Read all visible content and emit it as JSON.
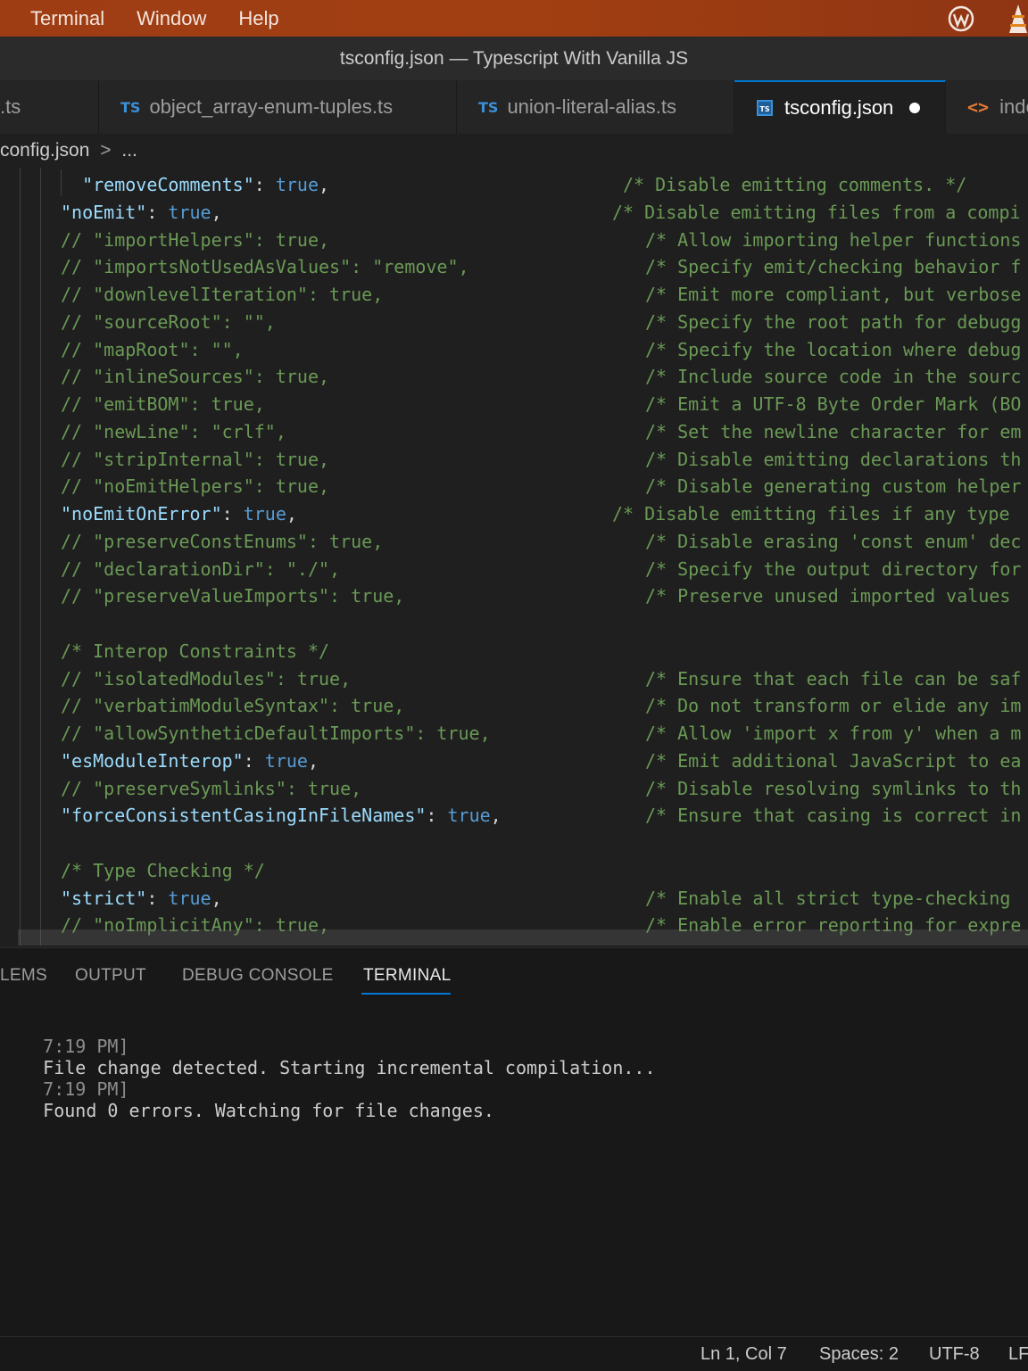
{
  "menubar": {
    "items": [
      "Terminal",
      "Window",
      "Help"
    ],
    "tray_icons": [
      "wordpress-icon",
      "vlc-icon"
    ]
  },
  "window": {
    "title": "tsconfig.json — Typescript With Vanilla JS"
  },
  "tabs": [
    {
      "icon": "ts-file-icon",
      "label": ".ts"
    },
    {
      "icon": "ts-file-icon",
      "badge": "TS",
      "label": "object_array-enum-tuples.ts"
    },
    {
      "icon": "ts-file-icon",
      "badge": "TS",
      "label": "union-literal-alias.ts"
    },
    {
      "icon": "tsconfig-file-icon",
      "label": "tsconfig.json",
      "active": true,
      "modified": true
    },
    {
      "icon": "html-file-icon",
      "label": "inde"
    }
  ],
  "breadcrumb": {
    "file": "config.json",
    "separator": ">",
    "more": "..."
  },
  "code_lines": [
    {
      "code": "  \"removeComments\": true,",
      "comment": "/* Disable emitting comments. */",
      "style": "active"
    },
    {
      "code": "\"noEmit\": true,",
      "comment": "/* Disable emitting files from a compi",
      "style": "active"
    },
    {
      "code": "// \"importHelpers\": true,",
      "comment": "/* Allow importing helper functions",
      "style": "commented"
    },
    {
      "code": "// \"importsNotUsedAsValues\": \"remove\",",
      "comment": "/* Specify emit/checking behavior f",
      "style": "commented"
    },
    {
      "code": "// \"downlevelIteration\": true,",
      "comment": "/* Emit more compliant, but verbose",
      "style": "commented"
    },
    {
      "code": "// \"sourceRoot\": \"\",",
      "comment": "/* Specify the root path for debugg",
      "style": "commented"
    },
    {
      "code": "// \"mapRoot\": \"\",",
      "comment": "/* Specify the location where debug",
      "style": "commented"
    },
    {
      "code": "// \"inlineSources\": true,",
      "comment": "/* Include source code in the sourc",
      "style": "commented"
    },
    {
      "code": "// \"emitBOM\": true,",
      "comment": "/* Emit a UTF-8 Byte Order Mark (BO",
      "style": "commented"
    },
    {
      "code": "// \"newLine\": \"crlf\",",
      "comment": "/* Set the newline character for em",
      "style": "commented"
    },
    {
      "code": "// \"stripInternal\": true,",
      "comment": "/* Disable emitting declarations th",
      "style": "commented"
    },
    {
      "code": "// \"noEmitHelpers\": true,",
      "comment": "/* Disable generating custom helper",
      "style": "commented"
    },
    {
      "code": "\"noEmitOnError\": true,",
      "comment": "/* Disable emitting files if any type",
      "style": "active"
    },
    {
      "code": "// \"preserveConstEnums\": true,",
      "comment": "/* Disable erasing 'const enum' dec",
      "style": "commented"
    },
    {
      "code": "// \"declarationDir\": \"./\",",
      "comment": "/* Specify the output directory for",
      "style": "commented"
    },
    {
      "code": "// \"preserveValueImports\": true,",
      "comment": "/* Preserve unused imported values",
      "style": "commented"
    },
    {
      "code": "",
      "comment": "",
      "style": "blank"
    },
    {
      "code": "/* Interop Constraints */",
      "comment": "",
      "style": "commented"
    },
    {
      "code": "// \"isolatedModules\": true,",
      "comment": "/* Ensure that each file can be saf",
      "style": "commented"
    },
    {
      "code": "// \"verbatimModuleSyntax\": true,",
      "comment": "/* Do not transform or elide any im",
      "style": "commented"
    },
    {
      "code": "// \"allowSyntheticDefaultImports\": true,",
      "comment": "/* Allow 'import x from y' when a m",
      "style": "commented"
    },
    {
      "code": "\"esModuleInterop\": true,",
      "comment": "/* Emit additional JavaScript to ea",
      "style": "active"
    },
    {
      "code": "// \"preserveSymlinks\": true,",
      "comment": "/* Disable resolving symlinks to th",
      "style": "commented"
    },
    {
      "code": "\"forceConsistentCasingInFileNames\": true,",
      "comment": "/* Ensure that casing is correct in",
      "style": "active"
    },
    {
      "code": "",
      "comment": "",
      "style": "blank"
    },
    {
      "code": "/* Type Checking */",
      "comment": "",
      "style": "commented"
    },
    {
      "code": "\"strict\": true,",
      "comment": "/* Enable all strict type-checking",
      "style": "active"
    },
    {
      "code": "// \"noImplicitAny\": true,",
      "comment": "/* Enable error reporting for expre",
      "style": "commented"
    }
  ],
  "panel": {
    "tabs": [
      "LEMS",
      "OUTPUT",
      "DEBUG CONSOLE",
      "TERMINAL"
    ],
    "active_tab": "TERMINAL",
    "terminal_lines": [
      {
        "time": "7:19 PM]",
        "message": "File change detected. Starting incremental compilation..."
      },
      {
        "time": "7:19 PM]",
        "message": "Found 0 errors. Watching for file changes."
      }
    ]
  },
  "statusbar": {
    "position": "Ln 1, Col 7",
    "spaces": "Spaces: 2",
    "encoding": "UTF-8",
    "eol": "LF"
  },
  "colors": {
    "menubar": "#a23f12",
    "accent": "#0078d4",
    "ts_badge": "#3b8fd9",
    "json_key": "#9cdcfe",
    "json_bool": "#569cd6",
    "comment": "#6a9955",
    "html_icon": "#e37933"
  }
}
